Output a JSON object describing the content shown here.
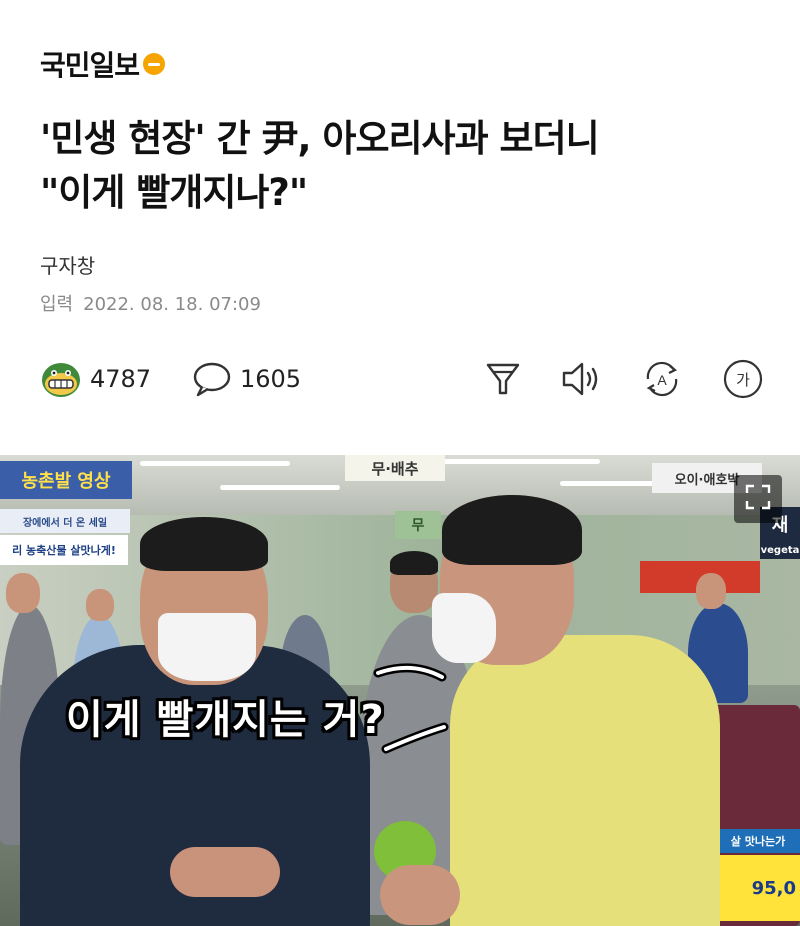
{
  "publisher": {
    "name": "국민일보"
  },
  "article": {
    "headline_line1": "'민생 현장' 간 尹, 아오리사과 보더니",
    "headline_line2": "\"이게 빨개지나?\"",
    "author": "구자창",
    "date_label": "입력",
    "date_value": "2022. 08. 18. 07:09"
  },
  "toolbar": {
    "reactions_count": "4787",
    "comments_count": "1605",
    "items": [
      "reaction-icon",
      "comment-icon",
      "summary-icon",
      "audio-icon",
      "translate-icon",
      "font-size-icon"
    ],
    "font_size_glyph": "가",
    "translate_glyph": "A"
  },
  "photo": {
    "caption": "이게 빨개지는 거?",
    "signs": {
      "top_left": "농촌발 영상",
      "top_center": "무·배추",
      "top_right": "오이·애호박",
      "left_banner_1": "장에에서 더 온 세일",
      "left_banner_2": "리 농축산물 살맛나게!",
      "right_vertical": "재",
      "right_small": "vegeta",
      "bottom_right": "살 맛나는가",
      "price_tag": "95,0",
      "wall_tag": "무"
    },
    "fullscreen_icon": "expand-icon"
  },
  "colors": {
    "brand_badge": "#f5a400",
    "jacket_yellow": "#e6e07a",
    "jacket_navy": "#1f2b3f",
    "apple_green": "#7fbf3a"
  }
}
